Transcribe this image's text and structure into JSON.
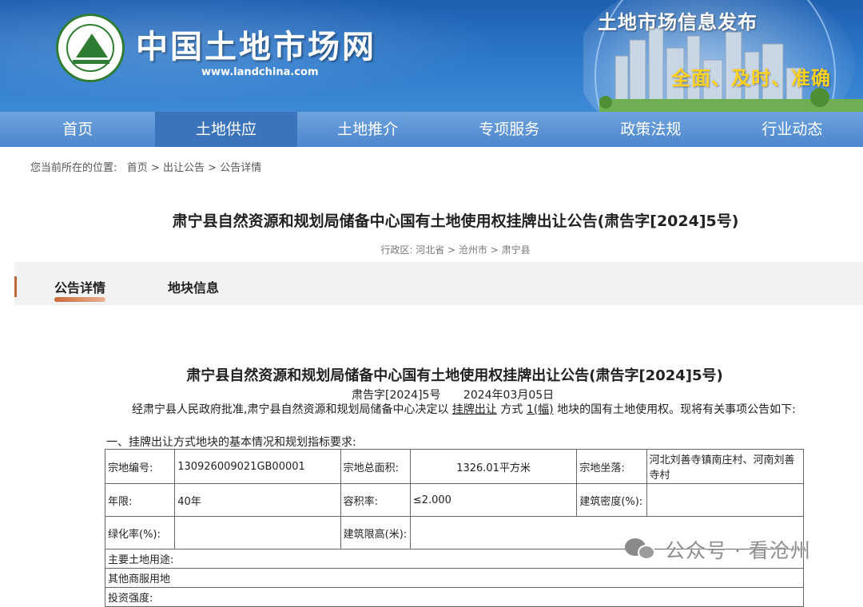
{
  "header": {
    "site_name": "中国土地市场网",
    "site_url": "www.landchina.com",
    "banner_title": "土地市场信息发布",
    "banner_slogan": "全面、及时、准确"
  },
  "nav": {
    "items": [
      "首页",
      "土地供应",
      "土地推介",
      "专项服务",
      "政策法规",
      "行业动态"
    ],
    "active_index": 1
  },
  "breadcrumb": {
    "prefix": "您当前所在的位置:",
    "items": [
      "首页",
      "出让公告",
      "公告详情"
    ],
    "separator": ">"
  },
  "page": {
    "title": "肃宁县自然资源和规划局储备中心国有土地使用权挂牌出让公告(肃告字[2024]5号)",
    "region_label": "行政区:",
    "region": [
      "河北省",
      "沧州市",
      "肃宁县"
    ]
  },
  "tabs": [
    "公告详情",
    "地块信息"
  ],
  "document": {
    "title": "肃宁县自然资源和规划局储备中心国有土地使用权挂牌出让公告(肃告字[2024]5号)",
    "number": "肃告字[2024]5号",
    "date": "2024年03月05日",
    "intro_part1": "经肃宁县人民政府批准,肃宁县自然资源和规划局储备中心决定以",
    "intro_method": "挂牌出让",
    "intro_part2": "方式",
    "intro_count": "1(幅)",
    "intro_part3": "地块的国有土地使用权。现将有关事项公告如下:",
    "section1": "一、挂牌出让方式地块的基本情况和规划指标要求:"
  },
  "parcel_table": {
    "parcel_no_label": "宗地编号:",
    "parcel_no": "130926009021GB00001",
    "area_label": "宗地总面积:",
    "area": "1326.01平方米",
    "location_label": "宗地坐落:",
    "location": "河北刘善寺镇南庄村、河南刘善寺村",
    "term_label": "年限:",
    "term": "40年",
    "far_label": "容积率:",
    "far": "≤2.000",
    "density_label": "建筑密度(%):",
    "density": "",
    "green_label": "绿化率(%):",
    "green": "",
    "height_label": "建筑限高(米):",
    "height": "",
    "use_label": "主要土地用途:",
    "use": "其他商服用地",
    "partial_label": "投资强度:"
  },
  "watermark": {
    "text": "公众号 · 看沧州",
    "icon": "wechat-icon"
  }
}
